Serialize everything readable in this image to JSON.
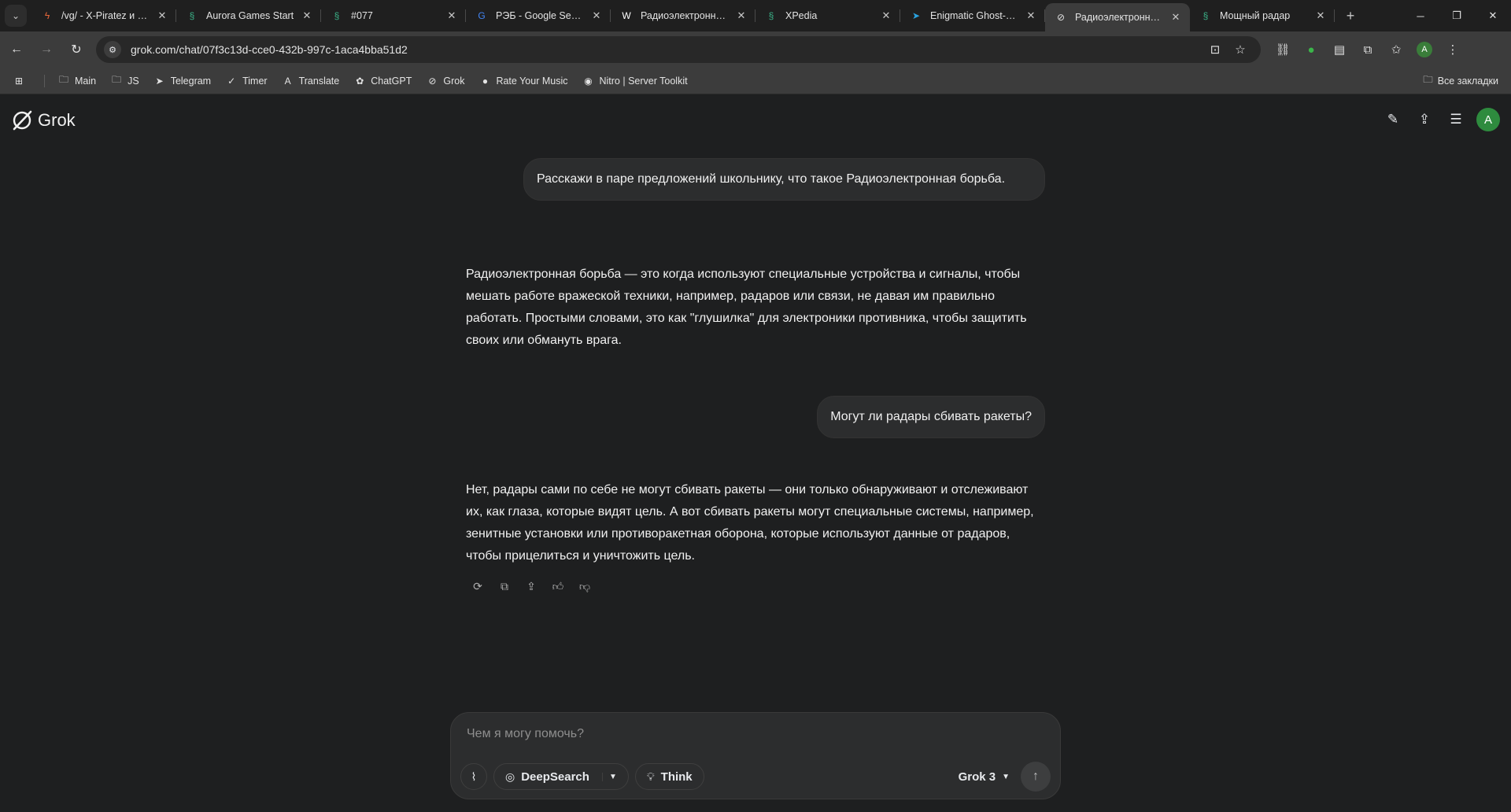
{
  "browser": {
    "tabs": [
      {
        "title": "/vg/ - X-Piratez и дру",
        "icon": "bolt-icon",
        "color": "#e8673a"
      },
      {
        "title": "Aurora Games Start",
        "icon": "dna-icon",
        "color": "#3bb58a"
      },
      {
        "title": "#077",
        "icon": "dna-icon",
        "color": "#3bb58a"
      },
      {
        "title": "РЭБ - Google Search",
        "icon": "google-icon",
        "color": "#4285f4"
      },
      {
        "title": "Радиоэлектронная б",
        "icon": "wikipedia-icon",
        "color": "#ffffff"
      },
      {
        "title": "XPedia",
        "icon": "dna-icon",
        "color": "#3bb58a"
      },
      {
        "title": "Enigmatic Ghost-clus",
        "icon": "telegram-icon",
        "color": "#2aa3e0"
      },
      {
        "title": "Радиоэлектронная б",
        "icon": "grok-icon",
        "color": "#e3e3e3",
        "active": true
      },
      {
        "title": "Мощный радар",
        "icon": "dna-icon",
        "color": "#3bb58a"
      }
    ],
    "url": "grok.com/chat/07f3c13d-cce0-432b-997c-1aca4bba51d2",
    "profile_initial": "A",
    "bookmarks": [
      {
        "label": "Main",
        "icon": "folder-icon"
      },
      {
        "label": "JS",
        "icon": "folder-icon"
      },
      {
        "label": "Telegram",
        "icon": "telegram-icon"
      },
      {
        "label": "Timer",
        "icon": "check-circle-icon"
      },
      {
        "label": "Translate",
        "icon": "translate-icon"
      },
      {
        "label": "ChatGPT",
        "icon": "chatgpt-icon"
      },
      {
        "label": "Grok",
        "icon": "grok-icon"
      },
      {
        "label": "Rate Your Music",
        "icon": "rym-icon"
      },
      {
        "label": "Nitro | Server Toolkit",
        "icon": "nitro-icon"
      }
    ],
    "all_bookmarks": "Все закладки"
  },
  "app": {
    "brand": "Grok",
    "user_initial": "A",
    "accent": "#2e8b3e"
  },
  "chat": {
    "user_msg_1": "Расскажи в паре предложений школьнику, что такое Радиоэлектронная борьба.",
    "bot_msg_1": "Радиоэлектронная борьба — это когда используют специальные устройства и сигналы, чтобы мешать работе вражеской техники, например, радаров или связи, не давая им правильно работать. Простыми словами, это как \"глушилка\" для электроники противника, чтобы защитить своих или обмануть врага.",
    "user_msg_2": "Могут ли радары сбивать ракеты?",
    "bot_msg_2": "Нет, радары сами по себе не могут сбивать ракеты — они только обнаруживают и отслеживают их, как глаза, которые видят цель. А вот сбивать ракеты могут специальные системы, например, зенитные установки или противоракетная оборона, которые используют данные от радаров, чтобы прицелиться и уничтожить цель."
  },
  "composer": {
    "placeholder": "Чем я могу помочь?",
    "deepsearch_label": "DeepSearch",
    "think_label": "Think",
    "model_label": "Grok 3"
  }
}
